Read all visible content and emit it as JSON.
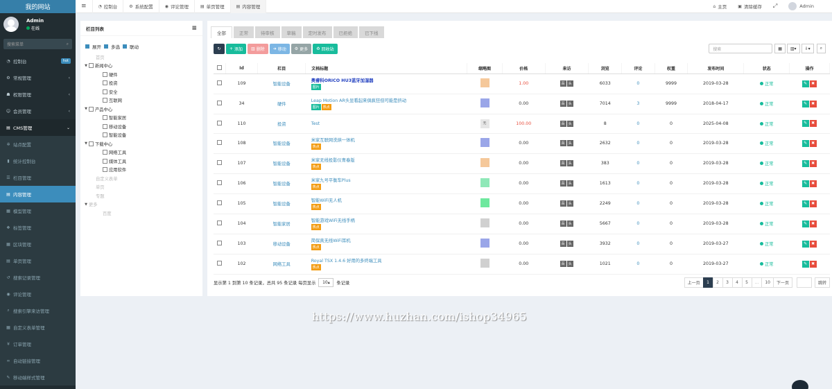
{
  "sidebar": {
    "brand": "我的网站",
    "user": {
      "name": "Admin",
      "status": "在线"
    },
    "search_placeholder": "搜索菜单",
    "search_icon": "search-icon",
    "items": [
      {
        "label": "控制台",
        "icon": "dashboard-icon",
        "badge": "hot",
        "state": "normal"
      },
      {
        "label": "常规管理",
        "icon": "cog-icon",
        "state": "normal",
        "arrow": "‹"
      },
      {
        "label": "权限管理",
        "icon": "group-icon",
        "state": "normal",
        "arrow": "‹"
      },
      {
        "label": "会员管理",
        "icon": "user-icon",
        "state": "normal",
        "arrow": "‹"
      },
      {
        "label": "CMS管理",
        "icon": "file-icon",
        "state": "open",
        "arrow": "⌄"
      },
      {
        "label": "站点配置",
        "icon": "gears-icon",
        "state": "sub"
      },
      {
        "label": "统计控制台",
        "icon": "bar-chart-icon",
        "state": "sub"
      },
      {
        "label": "栏目管理",
        "icon": "list-icon",
        "state": "sub"
      },
      {
        "label": "内容管理",
        "icon": "file-text-icon",
        "state": "active"
      },
      {
        "label": "模型管理",
        "icon": "th-icon",
        "state": "sub"
      },
      {
        "label": "标签管理",
        "icon": "tags-icon",
        "state": "sub"
      },
      {
        "label": "区块管理",
        "icon": "th-large-icon",
        "state": "sub"
      },
      {
        "label": "单页管理",
        "icon": "file-icon",
        "state": "sub"
      },
      {
        "label": "搜索记录管理",
        "icon": "history-icon",
        "state": "sub"
      },
      {
        "label": "评论管理",
        "icon": "comment-icon",
        "state": "sub"
      },
      {
        "label": "搜索引擎来访管理",
        "icon": "search-icon",
        "state": "sub"
      },
      {
        "label": "自定义表单管理",
        "icon": "table-icon",
        "state": "sub"
      },
      {
        "label": "订单管理",
        "icon": "yen-icon",
        "state": "sub"
      },
      {
        "label": "自动链接管理",
        "icon": "link-icon",
        "state": "sub"
      },
      {
        "label": "移动端样式管理",
        "icon": "magic-icon",
        "state": "sub"
      }
    ]
  },
  "topbar": {
    "tabs": [
      {
        "label": "控制台",
        "icon": "dashboard-icon"
      },
      {
        "label": "系统配置",
        "icon": "cog-icon"
      },
      {
        "label": "评论管理",
        "icon": "comment-icon"
      },
      {
        "label": "单页管理",
        "icon": "file-icon"
      },
      {
        "label": "内容管理",
        "icon": "file-text-icon",
        "active": true
      }
    ],
    "home": "主页",
    "clear_cache": "清除缓存",
    "user": "Admin"
  },
  "category_panel": {
    "title": "栏目列表",
    "options": [
      {
        "label": "展开",
        "checked": true
      },
      {
        "label": "多选",
        "checked": true
      },
      {
        "label": "联动",
        "checked": true
      }
    ],
    "tree": [
      {
        "label": "首页",
        "level": 1,
        "toggle": "",
        "grey": true,
        "box": false
      },
      {
        "label": "新闻中心",
        "level": 0,
        "toggle": "▼",
        "grey": false,
        "box": true
      },
      {
        "label": "硬件",
        "level": 2,
        "toggle": "",
        "grey": false,
        "box": true
      },
      {
        "label": "投资",
        "level": 2,
        "toggle": "",
        "grey": false,
        "box": true
      },
      {
        "label": "安全",
        "level": 2,
        "toggle": "",
        "grey": false,
        "box": true
      },
      {
        "label": "互联网",
        "level": 2,
        "toggle": "",
        "grey": false,
        "box": true
      },
      {
        "label": "产品中心",
        "level": 0,
        "toggle": "▼",
        "grey": false,
        "box": true
      },
      {
        "label": "智能家居",
        "level": 2,
        "toggle": "",
        "grey": false,
        "box": true
      },
      {
        "label": "移动设备",
        "level": 2,
        "toggle": "",
        "grey": false,
        "box": true
      },
      {
        "label": "智能设备",
        "level": 2,
        "toggle": "",
        "grey": false,
        "box": true
      },
      {
        "label": "下载中心",
        "level": 0,
        "toggle": "▼",
        "grey": false,
        "box": true
      },
      {
        "label": "网络工具",
        "level": 2,
        "toggle": "",
        "grey": false,
        "box": true
      },
      {
        "label": "媒体工具",
        "level": 2,
        "toggle": "",
        "grey": false,
        "box": true
      },
      {
        "label": "应用软件",
        "level": 2,
        "toggle": "",
        "grey": false,
        "box": true
      },
      {
        "label": "自定义表单",
        "level": 1,
        "toggle": "",
        "grey": true,
        "box": false
      },
      {
        "label": "单页",
        "level": 1,
        "toggle": "",
        "grey": true,
        "box": false
      },
      {
        "label": "专题",
        "level": 1,
        "toggle": "",
        "grey": true,
        "box": false
      },
      {
        "label": "更多",
        "level": 0,
        "toggle": "▼",
        "grey": true,
        "box": false
      },
      {
        "label": "百度",
        "level": 2,
        "toggle": "",
        "grey": true,
        "box": false
      }
    ]
  },
  "status_tabs": [
    "全部",
    "正常",
    "待审核",
    "草稿",
    "定时发布",
    "已拒绝",
    "已下线"
  ],
  "toolbar": {
    "add": "添加",
    "delete": "删除",
    "move": "移动",
    "more": "更多",
    "recycle": "回收站",
    "search_placeholder": "搜索"
  },
  "table": {
    "headers": [
      "Id",
      "栏目",
      "文档标题",
      "缩略图",
      "价格",
      "来访",
      "浏览",
      "评论",
      "权重",
      "发布时间",
      "状态",
      "操作"
    ],
    "rows": [
      {
        "id": "109",
        "cat": "智能设备",
        "title": "奥睿科ORICO HU3蓝牙加湿器",
        "bold": true,
        "labels": [
          [
            "图片",
            "g"
          ]
        ],
        "thumb": "#f5c89a",
        "price": "1.00",
        "price_red": true,
        "src": [
          "百",
          "头"
        ],
        "views": "6033",
        "comments": "0",
        "weight": "9999",
        "date": "2019-03-28",
        "status": "正常"
      },
      {
        "id": "34",
        "cat": "硬件",
        "title": "Leap Motion AR头显看起来俱疯狂但可能是挤动",
        "bold": false,
        "labels": [
          [
            "图片",
            "g"
          ],
          [
            "热点",
            "o"
          ]
        ],
        "thumb": "#9aa6e8",
        "price": "0.00",
        "price_red": false,
        "src": [
          "百",
          "头"
        ],
        "views": "7014",
        "comments": "3",
        "weight": "9999",
        "date": "2018-04-17",
        "status": "正常"
      },
      {
        "id": "110",
        "cat": "投资",
        "title": "Test",
        "bold": false,
        "labels": [],
        "thumb": "#e6e6e6",
        "thumb_text": "无",
        "price": "100.00",
        "price_red": true,
        "src": [
          "百",
          "头"
        ],
        "views": "8",
        "comments": "0",
        "weight": "0",
        "date": "2025-04-08",
        "status": "正常"
      },
      {
        "id": "108",
        "cat": "智能设备",
        "title": "米家互联网洗烘一体机",
        "bold": false,
        "labels": [
          [
            "热点",
            "o"
          ]
        ],
        "thumb": "#9aa6e8",
        "price": "0.00",
        "price_red": false,
        "src": [
          "百",
          "头"
        ],
        "views": "2632",
        "comments": "0",
        "weight": "0",
        "date": "2019-03-28",
        "status": "正常"
      },
      {
        "id": "107",
        "cat": "智能设备",
        "title": "米家无线投影仪青春版",
        "bold": false,
        "labels": [
          [
            "热点",
            "o"
          ]
        ],
        "thumb": "#f5c89a",
        "price": "0.00",
        "price_red": false,
        "src": [
          "百",
          "头"
        ],
        "views": "383",
        "comments": "0",
        "weight": "0",
        "date": "2019-03-28",
        "status": "正常"
      },
      {
        "id": "106",
        "cat": "智能设备",
        "title": "米家九号平衡车Plus",
        "bold": false,
        "labels": [
          [
            "热点",
            "o"
          ]
        ],
        "thumb": "#8fe8b8",
        "price": "0.00",
        "price_red": false,
        "src": [
          "百",
          "头"
        ],
        "views": "1613",
        "comments": "0",
        "weight": "0",
        "date": "2019-03-28",
        "status": "正常"
      },
      {
        "id": "105",
        "cat": "智能设备",
        "title": "智能WiFi无人机",
        "bold": false,
        "labels": [
          [
            "热点",
            "o"
          ]
        ],
        "thumb": "#6ee89e",
        "price": "0.00",
        "price_red": false,
        "src": [
          "百",
          "头"
        ],
        "views": "2249",
        "comments": "0",
        "weight": "0",
        "date": "2019-03-28",
        "status": "正常"
      },
      {
        "id": "104",
        "cat": "智能家居",
        "title": "智能游戏WiFi无线手柄",
        "bold": false,
        "labels": [
          [
            "热点",
            "o"
          ]
        ],
        "thumb": "#d0d0d0",
        "price": "0.00",
        "price_red": false,
        "src": [
          "百",
          "头"
        ],
        "views": "5667",
        "comments": "0",
        "weight": "0",
        "date": "2019-03-28",
        "status": "正常"
      },
      {
        "id": "103",
        "cat": "移动设备",
        "title": "简保真无线WiFi耳机",
        "bold": false,
        "labels": [
          [
            "热点",
            "o"
          ]
        ],
        "thumb": "#9aa6e8",
        "price": "0.00",
        "price_red": false,
        "src": [
          "百",
          "头"
        ],
        "views": "3932",
        "comments": "0",
        "weight": "0",
        "date": "2019-03-27",
        "status": "正常"
      },
      {
        "id": "102",
        "cat": "网络工具",
        "title": "Royal TSX 1.4.6 好用的多终端工具",
        "bold": false,
        "labels": [
          [
            "热点",
            "o"
          ]
        ],
        "thumb": "#d0d0d0",
        "price": "0.00",
        "price_red": false,
        "src": [
          "百",
          "头"
        ],
        "views": "1021",
        "comments": "0",
        "weight": "0",
        "date": "2019-03-27",
        "status": "正常"
      }
    ]
  },
  "pager": {
    "summary": "显示第 1 到第 10 条记录，总共 95 条记录 每页显示",
    "per_page": "10",
    "suffix": "条记录",
    "prev": "上一页",
    "pages": [
      "1",
      "2",
      "3",
      "4",
      "5",
      "...",
      "10"
    ],
    "next": "下一页",
    "jump": "跳转"
  },
  "watermark": "https://www.huzhan.com/ishop34965"
}
